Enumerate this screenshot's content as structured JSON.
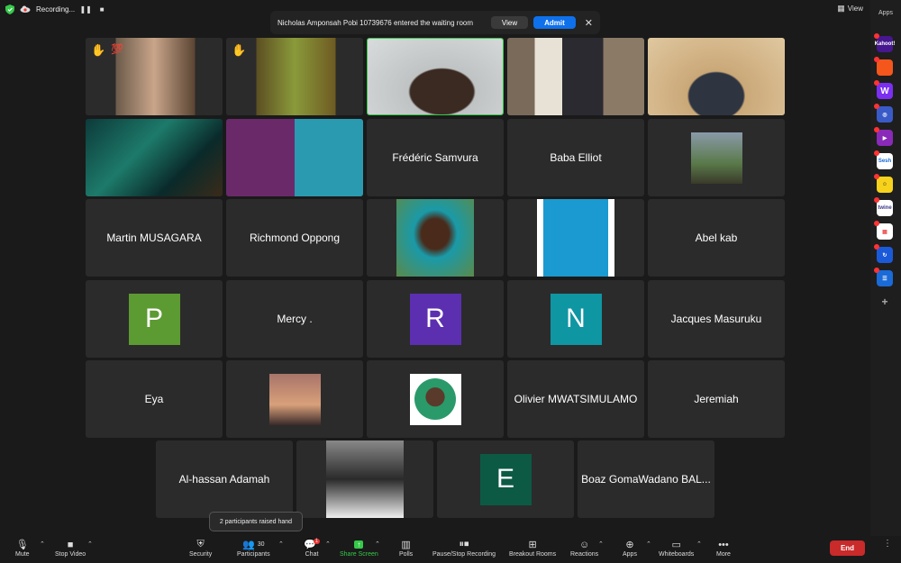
{
  "topbar": {
    "recording_label": "Recording...",
    "view_label": "View",
    "apps_label": "Apps"
  },
  "waiting_room": {
    "message": "Nicholas Amponsah Pobi 10739676 entered the waiting room",
    "view_label": "View",
    "admit_label": "Admit"
  },
  "participants": {
    "row1": [
      "",
      "",
      "",
      "",
      ""
    ],
    "row2": [
      "",
      "",
      "Frédéric Samvura",
      "Baba Elliot",
      ""
    ],
    "row3": [
      "Martin MUSAGARA",
      "Richmond Oppong",
      "",
      "",
      "Abel kab"
    ],
    "row4_letters": [
      "P",
      "R",
      "N"
    ],
    "row4_names": [
      "Mercy .",
      "Jacques Masuruku"
    ],
    "row5": [
      "Eya",
      "",
      "",
      "Olivier MWATSIMULAMO",
      "Jeremiah"
    ],
    "row6": [
      "Al-hassan Adamah",
      "",
      "E",
      "Boaz GomaWadano BAL..."
    ],
    "hand_emoji": "✋",
    "hundred_emoji": "💯"
  },
  "avatar_colors": {
    "P": "#5c9a32",
    "R": "#5b2fb0",
    "N": "#0e96a3",
    "E": "#0c5a44"
  },
  "apps": [
    "Kahoot!",
    "",
    "W",
    "",
    "",
    "Sesh",
    "",
    "twine",
    "",
    "",
    "",
    "+"
  ],
  "toolbar": {
    "mute": "Mute",
    "stop_video": "Stop Video",
    "security": "Security",
    "participants": "Participants",
    "participants_count": "30",
    "chat": "Chat",
    "chat_badge": "1",
    "share_screen": "Share Screen",
    "polls": "Polls",
    "recording": "Pause/Stop Recording",
    "breakout": "Breakout Rooms",
    "reactions": "Reactions",
    "apps": "Apps",
    "whiteboards": "Whiteboards",
    "more": "More",
    "end": "End"
  },
  "tooltip": "2 participants raised hand"
}
